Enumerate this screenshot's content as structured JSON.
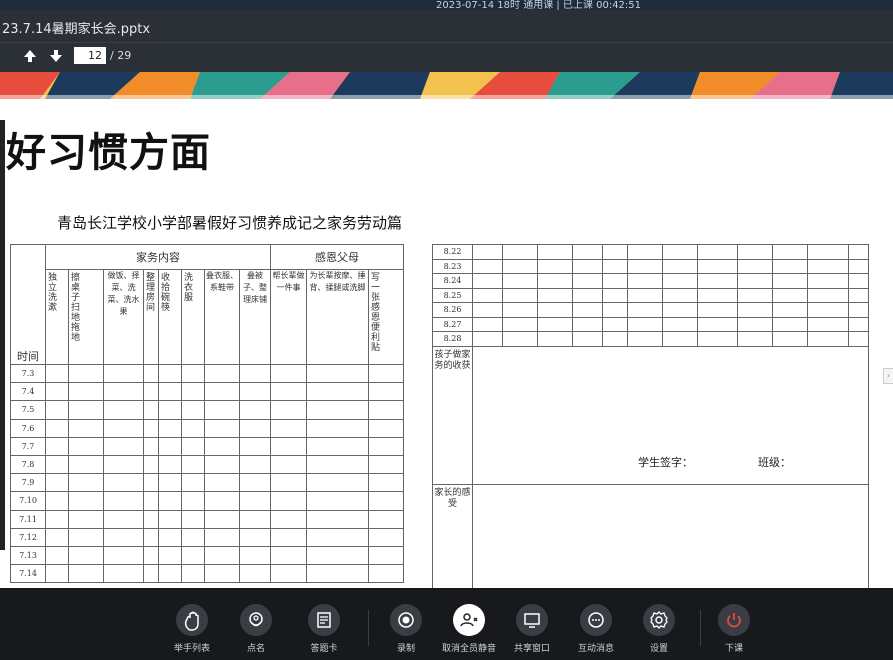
{
  "status": {
    "text": "2023-07-14 18时 通用课 | 已上课 00:42:51"
  },
  "window": {
    "title": "23.7.14暑期家长会.pptx"
  },
  "toolbar": {
    "prev_icon": "arrow-up-icon",
    "next_icon": "arrow-down-icon",
    "page_current": "12",
    "page_total": "/ 29"
  },
  "slide": {
    "heading": "好习惯方面",
    "doc_title": "青岛长江学校小学部暑假好习惯养成记之家务劳动篇",
    "left_table": {
      "group_housework": "家务内容",
      "group_gratitude": "感恩父母",
      "time_label": "时间",
      "columns": [
        "独立洗漱",
        "擦桌子扫地拖地",
        "做饭、择菜、洗菜、洗水果",
        "整理房间",
        "收拾碗筷",
        "洗衣服",
        "叠衣服、系鞋带",
        "叠被子、整理床铺",
        "帮长辈做一件事",
        "为长辈按摩、捶背、揉腿或洗脚",
        "写一张感恩便利贴"
      ],
      "dates": [
        "7.3",
        "7.4",
        "7.5",
        "7.6",
        "7.7",
        "7.8",
        "7.9",
        "7.10",
        "7.11",
        "7.12",
        "7.13",
        "7.14"
      ]
    },
    "right_table": {
      "dates": [
        "8.22",
        "8.23",
        "8.24",
        "8.25",
        "8.26",
        "8.27",
        "8.28"
      ],
      "harvest_label": "孩子做家务的收获",
      "student_sign": "学生签字：",
      "class_label": "班级：",
      "parent_label": "家长的感受"
    }
  },
  "controls": [
    {
      "label": "举手列表",
      "icon": "hand-icon"
    },
    {
      "label": "点名",
      "icon": "location-pin-icon"
    },
    {
      "label": "答题卡",
      "icon": "answer-card-icon"
    },
    {
      "label": "录制",
      "icon": "record-icon"
    },
    {
      "label": "取消全员静音",
      "icon": "unmute-all-icon"
    },
    {
      "label": "共享窗口",
      "icon": "share-window-icon"
    },
    {
      "label": "互动消息",
      "icon": "chat-icon"
    },
    {
      "label": "设置",
      "icon": "gear-icon"
    },
    {
      "label": "下课",
      "icon": "power-icon"
    }
  ],
  "colors": {
    "toolbar_bg": "#2b2f36",
    "bottom_bg": "#17191d",
    "end_class_red": "#e5483f",
    "unmute_active": "#ffffff"
  }
}
